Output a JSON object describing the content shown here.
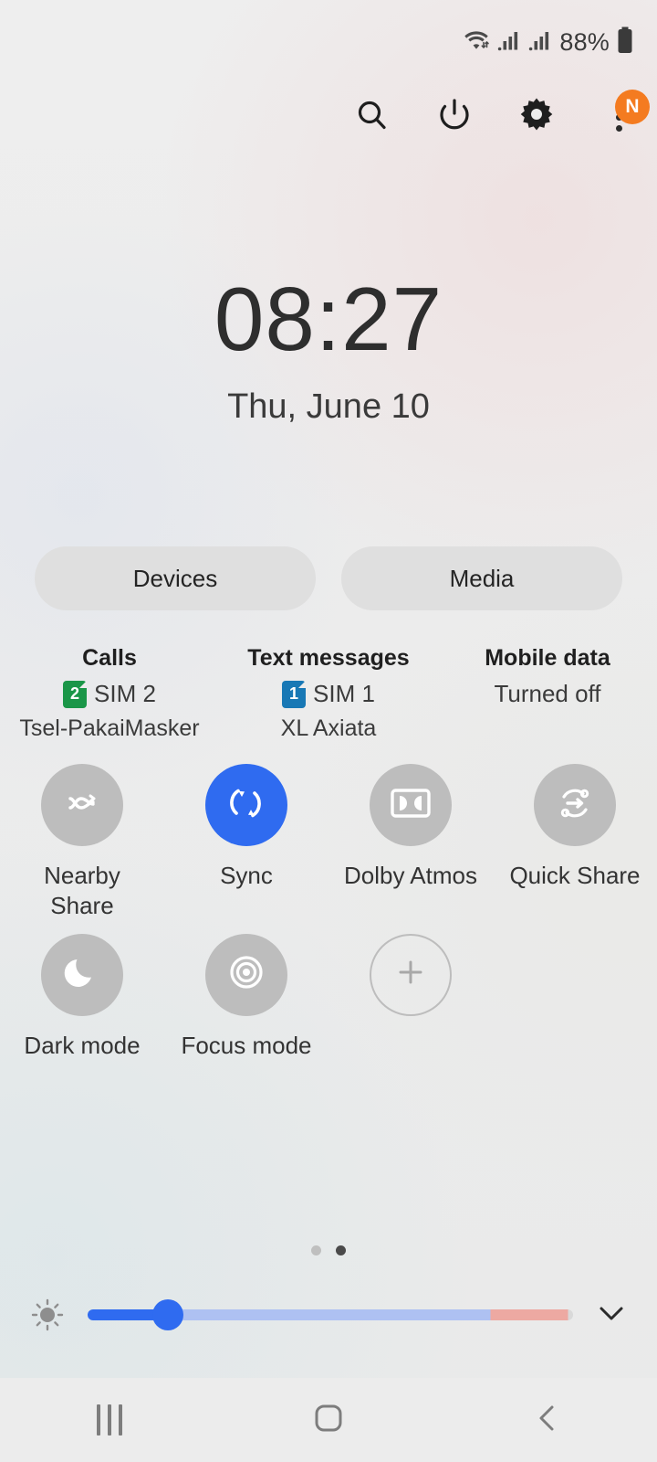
{
  "status_bar": {
    "wifi_icon": "wifi-icon",
    "signal_sim1_icon": "signal-bars-icon",
    "signal_sim2_icon": "signal-bars-icon",
    "battery_percent": "88%",
    "battery_icon": "battery-icon"
  },
  "header": {
    "search_icon": "search-icon",
    "power_icon": "power-icon",
    "settings_icon": "gear-icon",
    "more_icon": "more-options-icon",
    "badge_label": "N"
  },
  "clock": {
    "time": "08:27",
    "date": "Thu, June 10"
  },
  "pills": [
    {
      "label": "Devices",
      "name": "devices-button"
    },
    {
      "label": "Media",
      "name": "media-button"
    }
  ],
  "sim_info": [
    {
      "title": "Calls",
      "value": "SIM 2",
      "chip": "2",
      "chip_color": "#1a9648",
      "carrier": "Tsel-PakaiMasker"
    },
    {
      "title": "Text messages",
      "value": "SIM 1",
      "chip": "1",
      "chip_color": "#1878b5",
      "carrier": "XL Axiata"
    },
    {
      "title": "Mobile data",
      "value": "Turned off",
      "chip": "",
      "chip_color": "",
      "carrier": ""
    }
  ],
  "toggles": [
    {
      "label": "Nearby Share",
      "icon": "nearby-share-icon",
      "state": "off",
      "name": "toggle-nearby-share"
    },
    {
      "label": "Sync",
      "icon": "sync-icon",
      "state": "on",
      "name": "toggle-sync"
    },
    {
      "label": "Dolby Atmos",
      "icon": "dolby-atmos-icon",
      "state": "off",
      "name": "toggle-dolby-atmos"
    },
    {
      "label": "Quick Share",
      "icon": "quick-share-icon",
      "state": "off",
      "name": "toggle-quick-share"
    },
    {
      "label": "Dark mode",
      "icon": "moon-icon",
      "state": "off",
      "name": "toggle-dark-mode"
    },
    {
      "label": "Focus mode",
      "icon": "focus-target-icon",
      "state": "off",
      "name": "toggle-focus-mode"
    },
    {
      "label": "",
      "icon": "plus-icon",
      "state": "add",
      "name": "add-button"
    }
  ],
  "page_indicator": {
    "total": 2,
    "active": 2
  },
  "brightness": {
    "auto_icon": "brightness-auto-icon",
    "value_percent": 16,
    "expand_icon": "chevron-down-icon",
    "active_color": "#2f6bf0"
  },
  "nav_bar": {
    "recents_icon": "recents-icon",
    "home_icon": "home-icon",
    "back_icon": "back-icon"
  }
}
